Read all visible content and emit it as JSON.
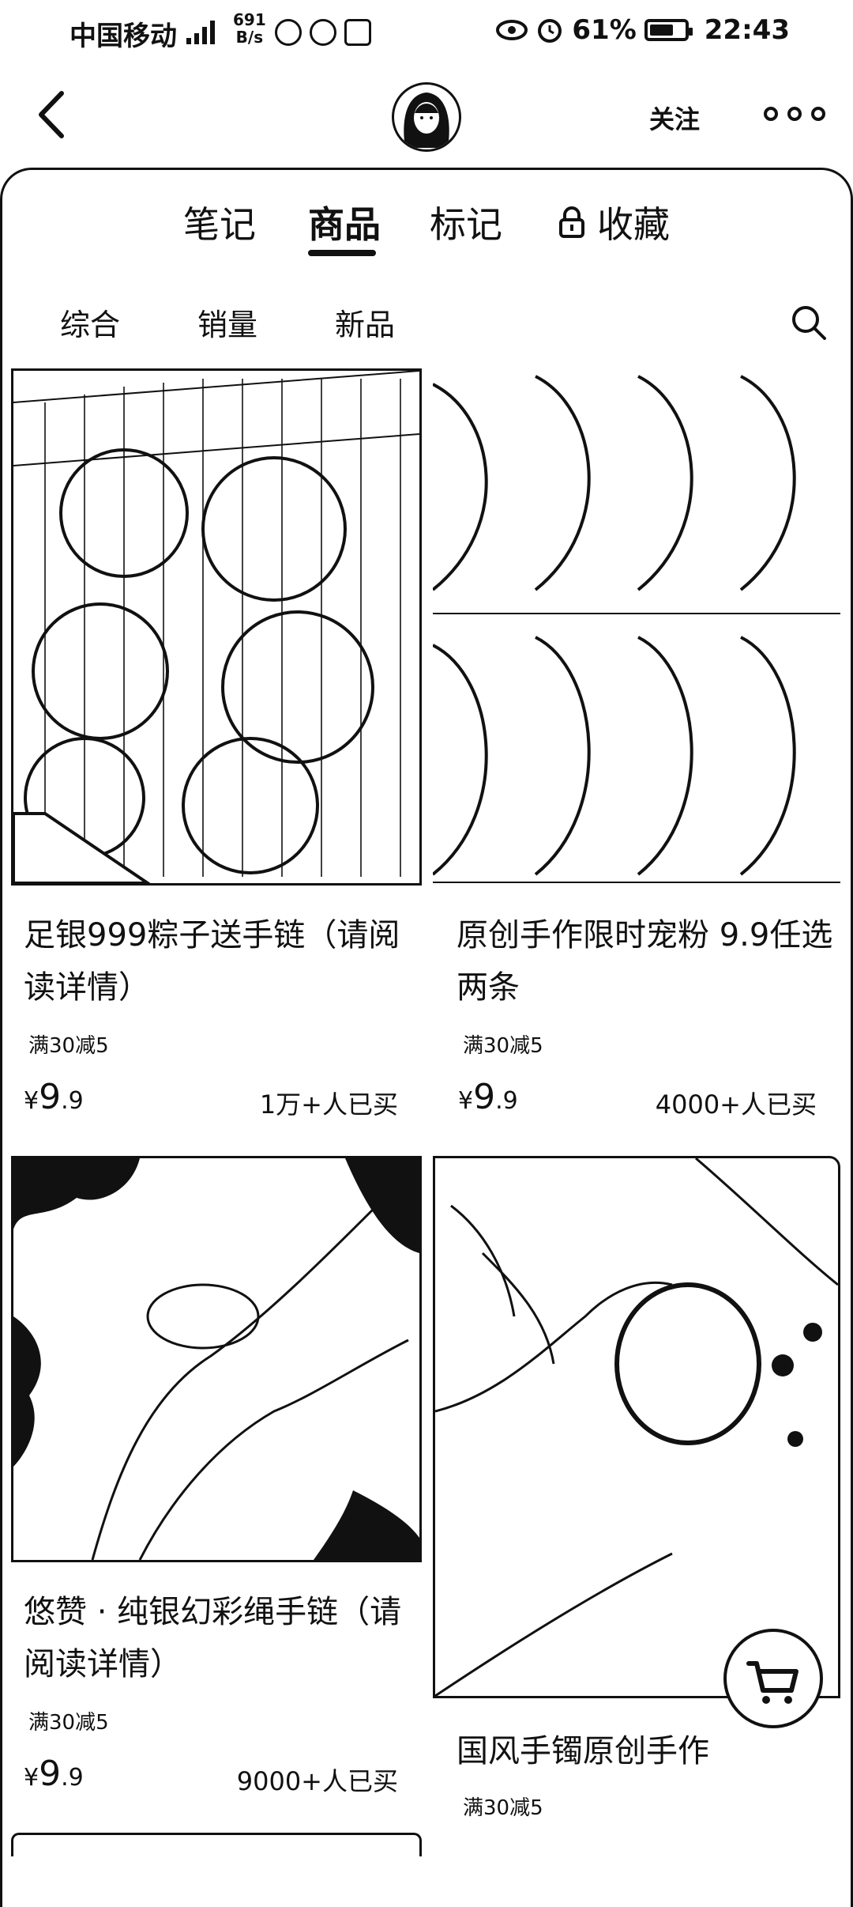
{
  "status_bar": {
    "carrier": "中国移动",
    "net_speed_value": "691",
    "net_speed_unit": "B/s",
    "battery": "61%",
    "time": "22:43"
  },
  "header": {
    "follow_label": "关注"
  },
  "tabs": [
    {
      "label": "笔记"
    },
    {
      "label": "商品",
      "active": true
    },
    {
      "label": "标记"
    },
    {
      "label": "收藏"
    }
  ],
  "filters": [
    "综合",
    "销量",
    "新品"
  ],
  "products": [
    {
      "title": "足银999粽子送手链（请阅读详情）",
      "promo": "满30减5",
      "price_symbol": "¥",
      "price_int": "9",
      "price_dec": ".9",
      "sold": "1万+人已买"
    },
    {
      "title": "原创手作限时宠粉 9.9任选两条",
      "promo": "满30减5",
      "price_symbol": "¥",
      "price_int": "9",
      "price_dec": ".9",
      "sold": "4000+人已买"
    },
    {
      "title": "悠赞 · 纯银幻彩绳手链（请阅读详情）",
      "promo": "满30减5",
      "price_symbol": "¥",
      "price_int": "9",
      "price_dec": ".9",
      "sold": "9000+人已买"
    },
    {
      "title": "国风手镯原创手作",
      "promo": "满30减5",
      "price_symbol": "",
      "price_int": "",
      "price_dec": "",
      "sold": ""
    }
  ]
}
